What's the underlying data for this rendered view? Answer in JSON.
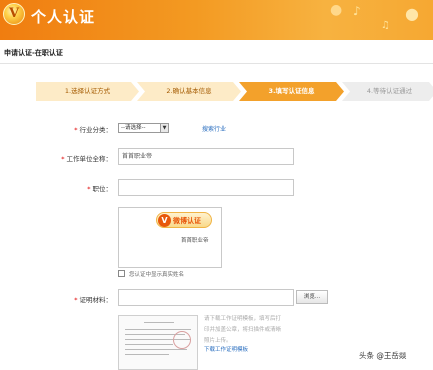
{
  "header": {
    "logo_glyph": "V",
    "title": "个人认证"
  },
  "page": {
    "title": "申请认证-在职认证"
  },
  "steps": [
    {
      "label": "1.选择认证方式",
      "state": "done"
    },
    {
      "label": "2.确认基本信息",
      "state": "done"
    },
    {
      "label": "3.填写认证信息",
      "state": "active"
    },
    {
      "label": "4.等待认证通过",
      "state": "pending"
    }
  ],
  "form": {
    "industry": {
      "label": "行业分类：",
      "value": "--请选择--",
      "link": "搜索行业"
    },
    "company": {
      "label": "工作单位全称：",
      "value": "首首职业帝"
    },
    "position": {
      "label": "职位：",
      "value": ""
    },
    "preview": {
      "badge": "微博认证",
      "company": "首首职业帝"
    },
    "real_name": {
      "label": "您认证中显示真实姓名"
    },
    "materials": {
      "label": "证明材料：",
      "value": "",
      "browse": "浏览..."
    },
    "hint": "请下载工作证明模板，填写后打印并加盖公章，将扫描件或清晰照片上传。",
    "download_link": "下载工作证明模板"
  },
  "watermark": "头条 @王岳燚",
  "colors": {
    "brand_orange": "#f3a12b",
    "required": "#e00000",
    "link": "#2b6fc0"
  }
}
